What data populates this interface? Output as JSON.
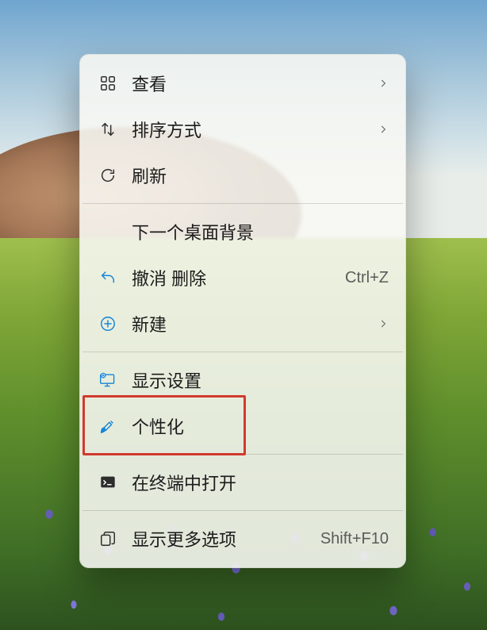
{
  "menu": {
    "view": {
      "label": "查看"
    },
    "sort": {
      "label": "排序方式"
    },
    "refresh": {
      "label": "刷新"
    },
    "next_bg": {
      "label": "下一个桌面背景"
    },
    "undo": {
      "label": "撤消 删除",
      "shortcut": "Ctrl+Z"
    },
    "new": {
      "label": "新建"
    },
    "display": {
      "label": "显示设置"
    },
    "personalize": {
      "label": "个性化"
    },
    "terminal": {
      "label": "在终端中打开"
    },
    "more": {
      "label": "显示更多选项",
      "shortcut": "Shift+F10"
    }
  }
}
